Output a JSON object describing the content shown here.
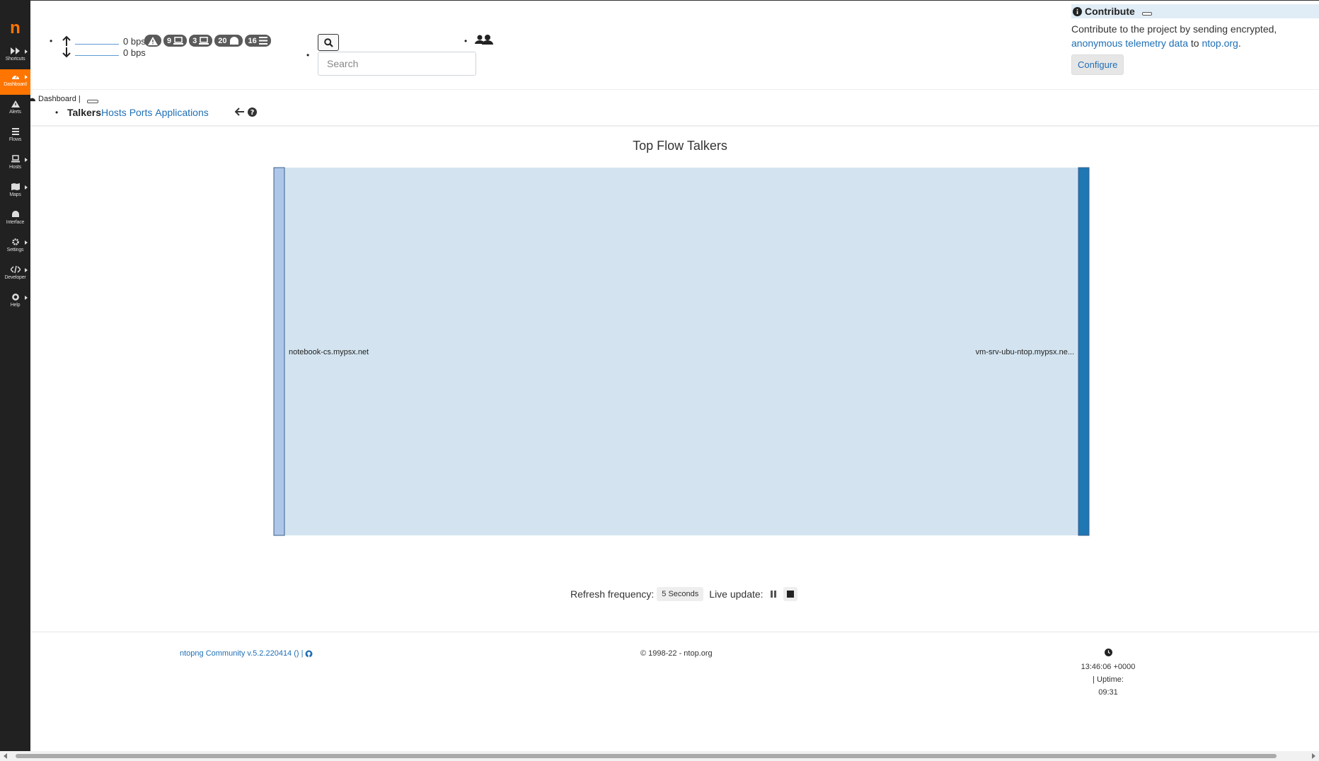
{
  "app": {
    "logo": "n"
  },
  "sidebar": {
    "items": [
      {
        "label": "Shortcuts",
        "icon": "fast-forward-icon"
      },
      {
        "label": "Dashboard",
        "icon": "dashboard-icon",
        "active": true
      },
      {
        "label": "Alerts",
        "icon": "warning-icon"
      },
      {
        "label": "Flows",
        "icon": "list-icon"
      },
      {
        "label": "Hosts",
        "icon": "laptop-icon"
      },
      {
        "label": "Maps",
        "icon": "map-icon"
      },
      {
        "label": "Interface",
        "icon": "ethernet-icon"
      },
      {
        "label": "Settings",
        "icon": "gear-icon"
      },
      {
        "label": "Developer",
        "icon": "code-icon"
      },
      {
        "label": "Help",
        "icon": "life-ring-icon"
      }
    ]
  },
  "header": {
    "traffic_up": "0 bps",
    "traffic_down": "0 bps",
    "badges": {
      "hosts_local": "9",
      "hosts_remote": "3",
      "devices": "20",
      "flows": "16"
    },
    "search": {
      "placeholder": "Search"
    }
  },
  "contribute": {
    "title": "Contribute",
    "text_before": "Contribute to the project by sending encrypted,",
    "link_telemetry": "anonymous telemetry data",
    "text_mid": " to ",
    "link_ntop": "ntop.org",
    "text_after": ".",
    "configure_label": "Configure"
  },
  "subnav": {
    "breadcrumb": "Dashboard",
    "tabs": [
      "Talkers",
      "Hosts",
      "Ports",
      "Applications"
    ],
    "active_tab": "Talkers"
  },
  "chart_data": {
    "type": "sankey",
    "title": "Top Flow Talkers",
    "nodes": [
      {
        "name": "notebook-cs.mypsx.net",
        "side": "left",
        "color": "#aec7e8"
      },
      {
        "name": "vm-srv-ubu-ntop.mypsx.ne...",
        "side": "right",
        "color": "#1f77b4"
      }
    ],
    "links": [
      {
        "source": "notebook-cs.mypsx.net",
        "target": "vm-srv-ubu-ntop.mypsx.ne...",
        "value": 1
      }
    ]
  },
  "refresh": {
    "label": "Refresh frequency:",
    "value": "5 Seconds",
    "live_label": "Live update:"
  },
  "footer": {
    "version": "ntopng Community v.5.2.220414 () |",
    "copyright": "© 1998-22 - ntop.org",
    "time": "13:46:06 +0000",
    "uptime_label": "| Uptime:",
    "uptime_value": "09:31"
  }
}
